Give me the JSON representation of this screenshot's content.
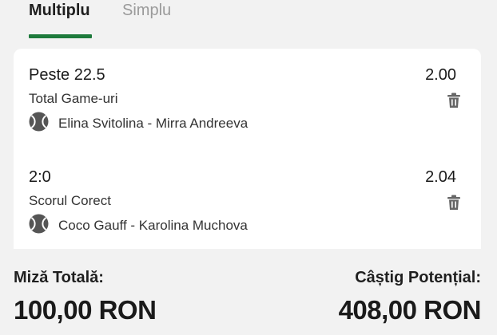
{
  "tabs": [
    {
      "label": "Multiplu",
      "active": true
    },
    {
      "label": "Simplu",
      "active": false
    }
  ],
  "accent_color": "#1e7a3c",
  "bets": [
    {
      "selection": "Peste 22.5",
      "market": "Total Game-uri",
      "odds": "2.00",
      "event": "Elina Svitolina - Mirra Andreeva",
      "sport_icon": "tennis-ball-icon",
      "remove_icon": "trash-icon"
    },
    {
      "selection": "2:0",
      "market": "Scorul Corect",
      "odds": "2.04",
      "event": "Coco Gauff - Karolina Muchova",
      "sport_icon": "tennis-ball-icon",
      "remove_icon": "trash-icon"
    }
  ],
  "summary": {
    "stake_label": "Miză Totală:",
    "stake_amount": "100,00 RON",
    "potential_win_label": "Câștig Potențial:",
    "potential_win_amount": "408,00 RON"
  }
}
